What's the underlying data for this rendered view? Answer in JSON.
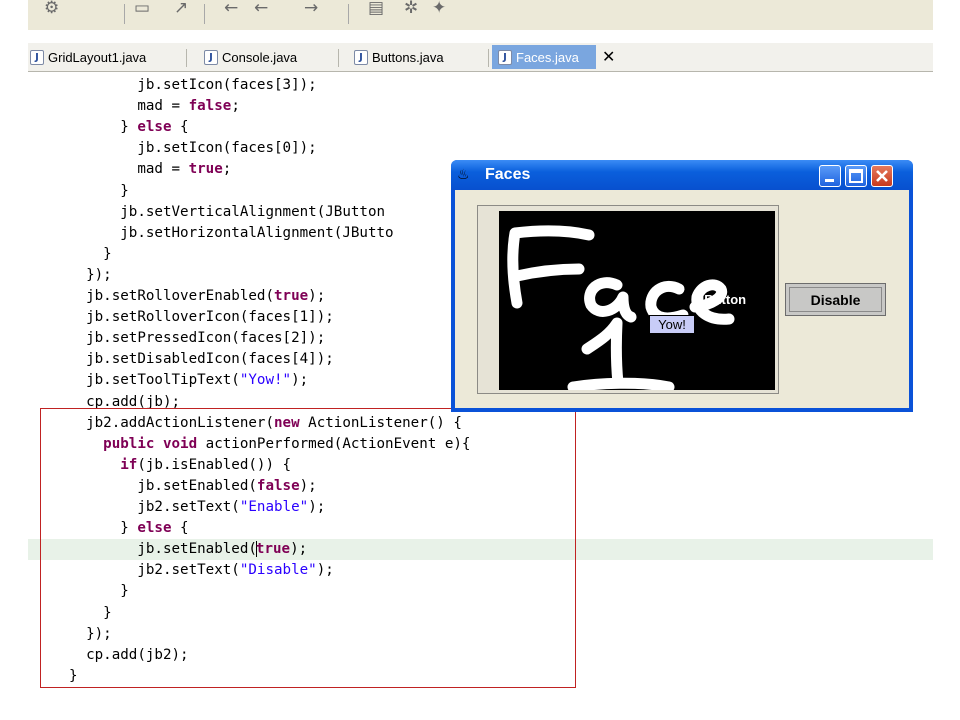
{
  "tabs": [
    {
      "label": "GridLayout1.java"
    },
    {
      "label": "Console.java"
    },
    {
      "label": "Buttons.java"
    },
    {
      "label": "Faces.java"
    }
  ],
  "tab_close_glyph": "✕",
  "code": {
    "lines": [
      [
        [
          "",
          "        jb.setIcon(faces[3]);"
        ]
      ],
      [
        [
          "",
          "        mad = "
        ],
        [
          "kw",
          "false"
        ],
        [
          "",
          ";"
        ]
      ],
      [
        [
          "",
          "      } "
        ],
        [
          "kw",
          "else"
        ],
        [
          "",
          " {"
        ]
      ],
      [
        [
          "",
          "        jb.setIcon(faces[0]);"
        ]
      ],
      [
        [
          "",
          "        mad = "
        ],
        [
          "kw",
          "true"
        ],
        [
          "",
          ";"
        ]
      ],
      [
        [
          "",
          "      }"
        ]
      ],
      [
        [
          "",
          "      jb.setVerticalAlignment(JButton"
        ]
      ],
      [
        [
          "",
          "      jb.setHorizontalAlignment(JButto"
        ]
      ],
      [
        [
          "",
          "    }"
        ]
      ],
      [
        [
          "",
          "  });"
        ]
      ],
      [
        [
          "",
          "  jb.setRolloverEnabled("
        ],
        [
          "kw",
          "true"
        ],
        [
          "",
          ");"
        ]
      ],
      [
        [
          "",
          "  jb.setRolloverIcon(faces[1]);"
        ]
      ],
      [
        [
          "",
          "  jb.setPressedIcon(faces[2]);"
        ]
      ],
      [
        [
          "",
          "  jb.setDisabledIcon(faces[4]);"
        ]
      ],
      [
        [
          "",
          "  jb.setToolTipText("
        ],
        [
          "str",
          "\"Yow!\""
        ],
        [
          "",
          ");"
        ]
      ],
      [
        [
          "",
          "  cp.add(jb);"
        ]
      ],
      [
        [
          "",
          "  jb2.addActionListener("
        ],
        [
          "kw",
          "new"
        ],
        [
          "",
          " ActionListener() {"
        ]
      ],
      [
        [
          "",
          "    "
        ],
        [
          "kw",
          "public void"
        ],
        [
          "",
          " actionPerformed(ActionEvent e){"
        ]
      ],
      [
        [
          "",
          "      "
        ],
        [
          "kw",
          "if"
        ],
        [
          "",
          "(jb.isEnabled()) {"
        ]
      ],
      [
        [
          "",
          "        jb.setEnabled("
        ],
        [
          "kw",
          "false"
        ],
        [
          "",
          ");"
        ]
      ],
      [
        [
          "",
          "        jb2.setText("
        ],
        [
          "str",
          "\"Enable\""
        ],
        [
          "",
          ");"
        ]
      ],
      [
        [
          "",
          "      } "
        ],
        [
          "kw",
          "else"
        ],
        [
          "",
          " {"
        ]
      ],
      [
        [
          "",
          "        jb.setEnabled("
        ],
        [
          "caret",
          ""
        ],
        [
          "kw",
          "true"
        ],
        [
          "",
          ");"
        ]
      ],
      [
        [
          "",
          "        jb2.setText("
        ],
        [
          "str",
          "\"Disable\""
        ],
        [
          "",
          ");"
        ]
      ],
      [
        [
          "",
          "      }"
        ]
      ],
      [
        [
          "",
          "    }"
        ]
      ],
      [
        [
          "",
          "  });"
        ]
      ],
      [
        [
          "",
          "  cp.add(jb2);"
        ]
      ],
      [
        [
          "",
          "}"
        ]
      ]
    ],
    "current_line": 22
  },
  "faces_window": {
    "title": "Faces",
    "image_text": "Face 1",
    "button_text": "JButton",
    "tooltip": "Yow!",
    "disable_label": "Disable"
  },
  "colors": {
    "keyword": "#7f0055",
    "string": "#2a00ff",
    "highlight": "#e3262a",
    "titlebar": "#0a5fdc"
  }
}
